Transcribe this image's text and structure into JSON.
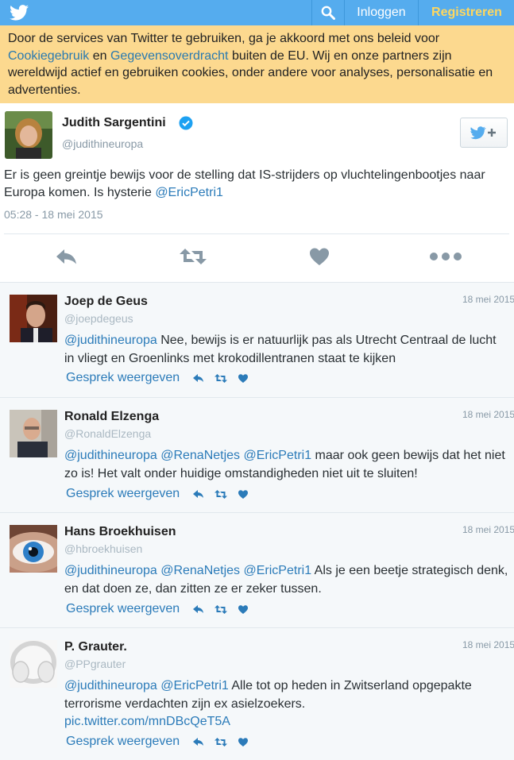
{
  "topbar": {
    "login_label": "Inloggen",
    "register_label": "Registreren",
    "brand_color": "#55acee",
    "register_color": "#ffd75e"
  },
  "banner": {
    "text_1": "Door de services van Twitter te gebruiken, ga je akkoord met ons beleid voor ",
    "link_cookie": "Cookiegebruik",
    "text_2": " en ",
    "link_data": "Gegevensoverdracht",
    "text_3": " buiten de EU. Wij en onze partners zijn wereldwijd actief en gebruiken cookies, onder andere voor analyses, personalisatie en advertenties."
  },
  "tweet": {
    "author_name": "Judith Sargentini",
    "author_handle": "@judithineuropa",
    "text_1": "Er is geen greintje bewijs voor de stelling dat IS-strijders op vluchtelingenbootjes naar Europa komen. Is hysterie ",
    "mention": "@EricPetri1",
    "timestamp": "05:28 - 18 mei 2015"
  },
  "replies": [
    {
      "name": "Joep de Geus",
      "handle": "@joepdegeus",
      "date": "18 mei 2015",
      "mentions": "@judithineuropa",
      "text": " Nee, bewijs is er natuurlijk pas als Utrecht Centraal de lucht in vliegt en Groenlinks met krokodillentranen staat te kijken",
      "link": "",
      "convo_label": "Gesprek weergeven"
    },
    {
      "name": "Ronald Elzenga",
      "handle": "@RonaldElzenga",
      "date": "18 mei 2015",
      "mentions": "@judithineuropa @RenaNetjes @EricPetri1",
      "text": " maar ook geen bewijs dat het niet zo is! Het valt onder huidige omstandigheden niet uit te sluiten!",
      "link": "",
      "convo_label": "Gesprek weergeven"
    },
    {
      "name": "Hans Broekhuisen",
      "handle": "@hbroekhuisen",
      "date": "18 mei 2015",
      "mentions": "@judithineuropa @RenaNetjes @EricPetri1",
      "text": " Als je een beetje strategisch denk, en dat doen ze, dan zitten ze er zeker tussen.",
      "link": "",
      "convo_label": "Gesprek weergeven"
    },
    {
      "name": "P. Grauter.",
      "handle": "@PPgrauter",
      "date": "18 mei 2015",
      "mentions": "@judithineuropa @EricPetri1",
      "text": " Alle tot op heden in Zwitserland opgepakte terrorisme verdachten zijn ex asielzoekers.",
      "link": "pic.twitter.com/mnDBcQeT5A",
      "convo_label": "Gesprek weergeven"
    }
  ]
}
